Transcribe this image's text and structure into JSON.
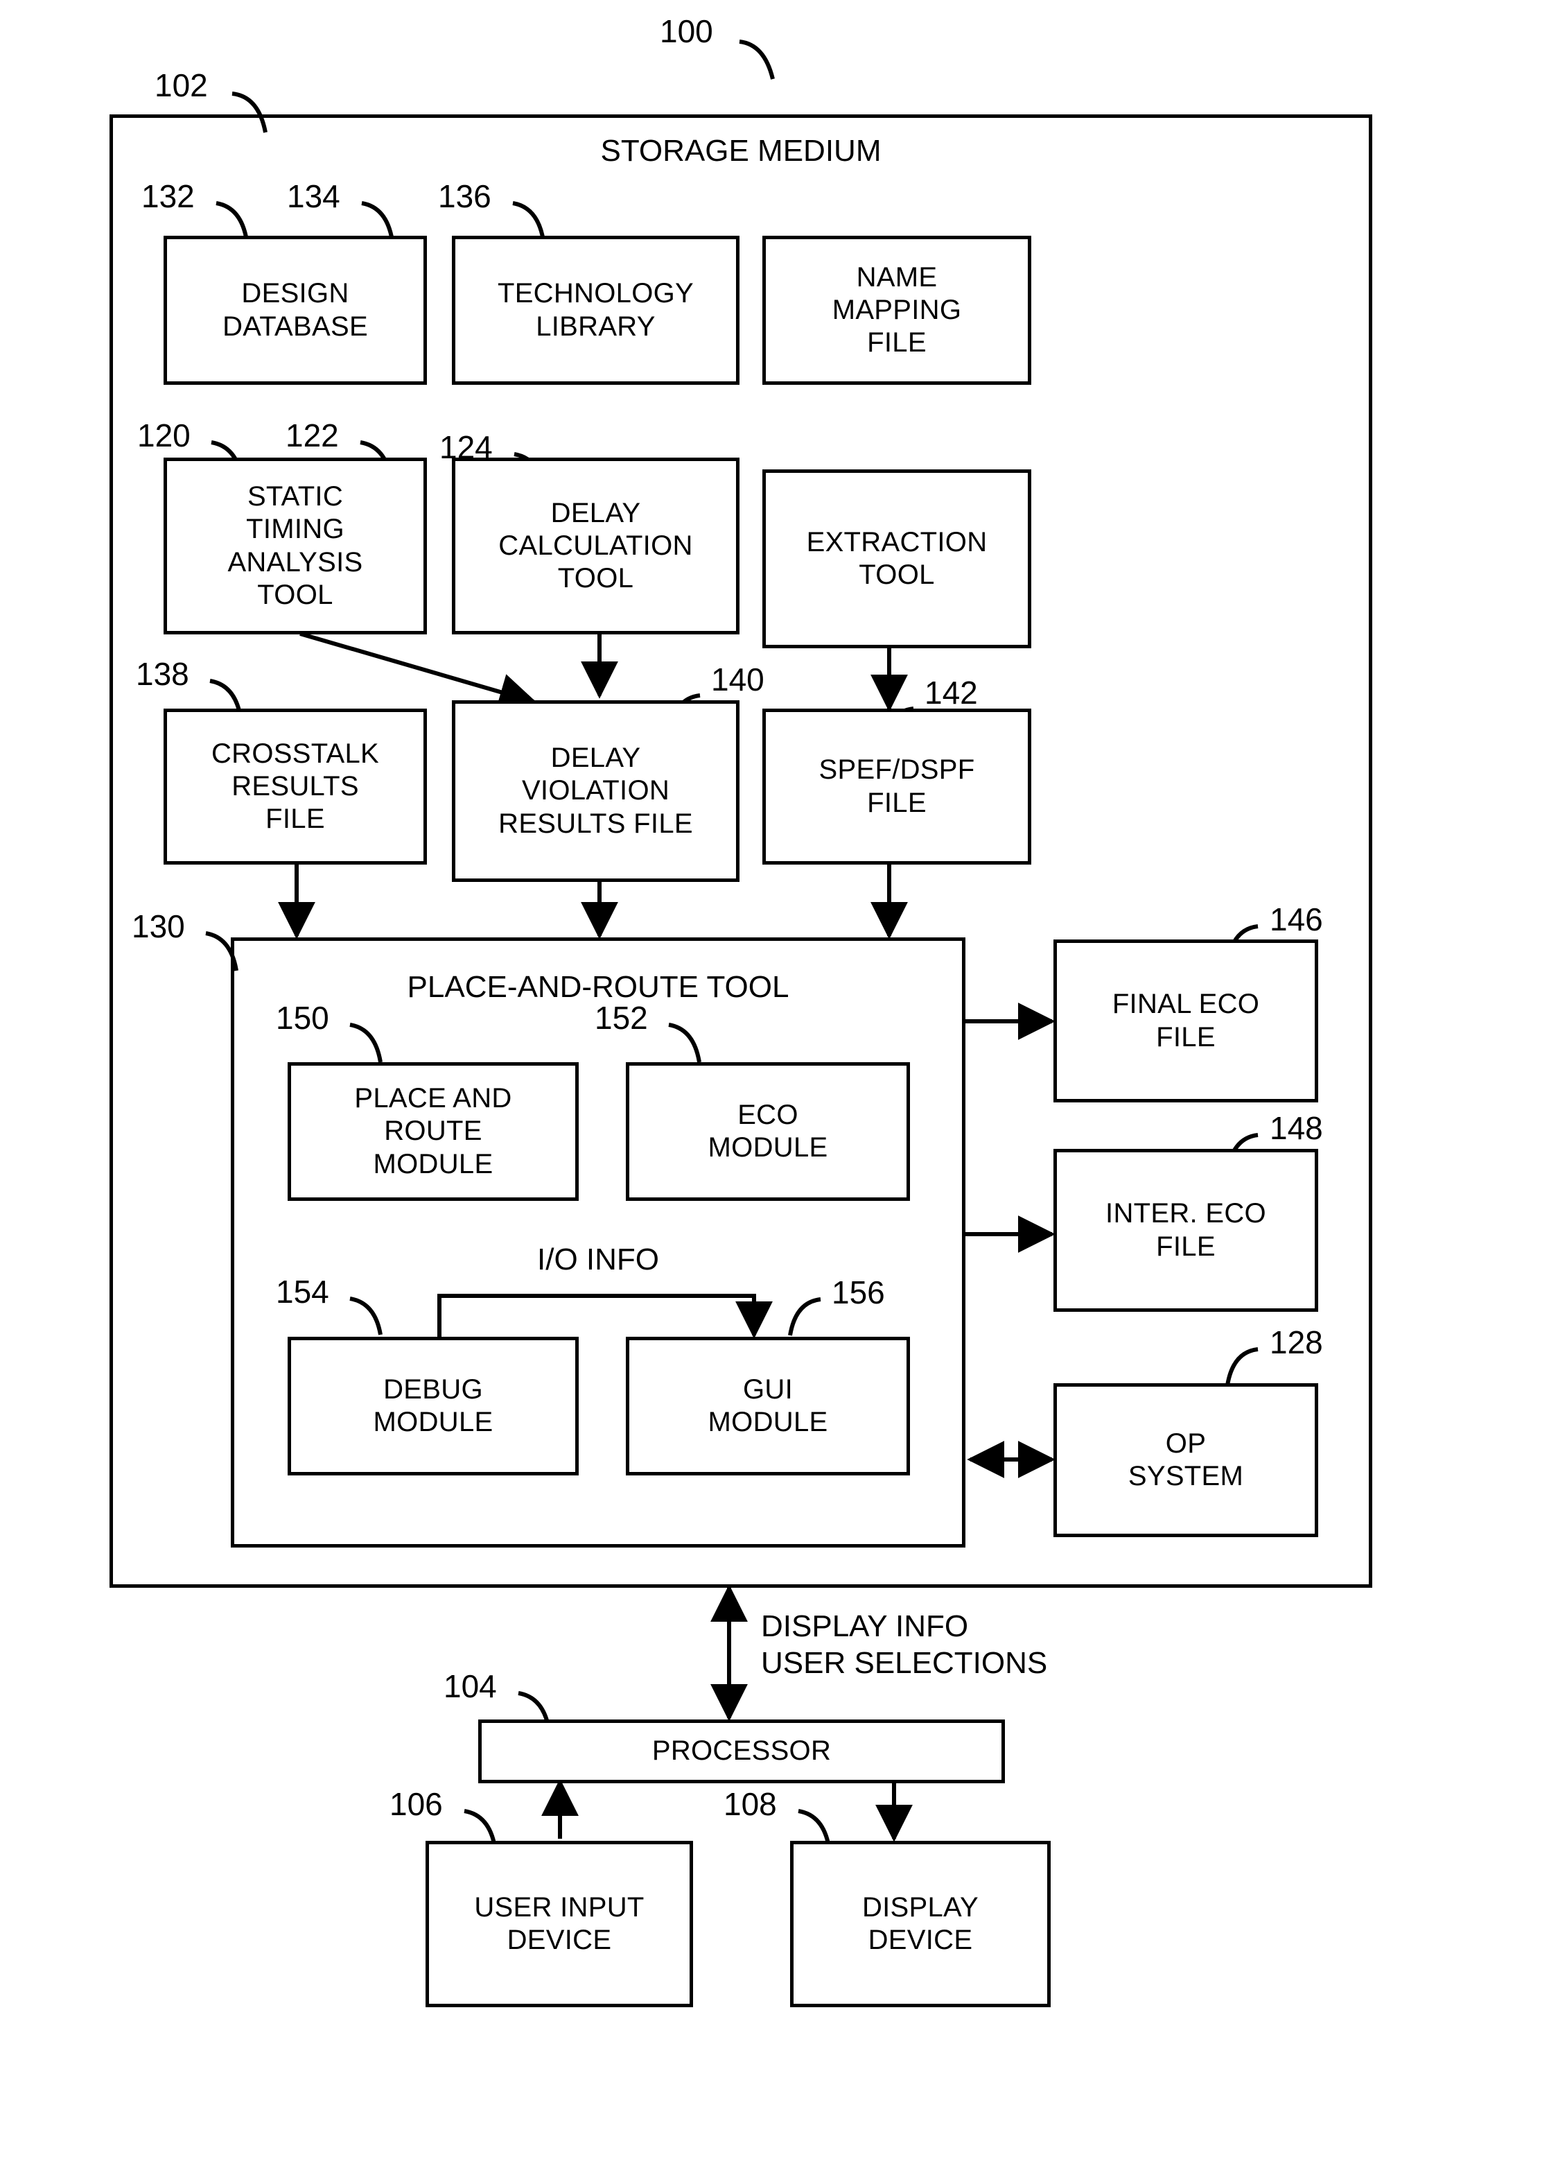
{
  "figure": {
    "top_ref": "100",
    "storage_medium": {
      "ref": "102",
      "title": "STORAGE MEDIUM"
    }
  },
  "blocks": {
    "design_database": {
      "ref": "132",
      "label": "DESIGN\nDATABASE"
    },
    "technology_library": {
      "ref": "134",
      "label": "TECHNOLOGY\nLIBRARY"
    },
    "name_mapping_file": {
      "ref": "136",
      "label": "NAME\nMAPPING\nFILE"
    },
    "static_timing": {
      "ref": "120",
      "label": "STATIC\nTIMING\nANALYSIS\nTOOL"
    },
    "delay_calculation": {
      "ref": "122",
      "label": "DELAY\nCALCULATION\nTOOL"
    },
    "extraction_tool": {
      "ref": "124",
      "label": "EXTRACTION\nTOOL"
    },
    "crosstalk_results": {
      "ref": "138",
      "label": "CROSSTALK\nRESULTS\nFILE"
    },
    "delay_violation": {
      "ref": "140",
      "label": "DELAY\nVIOLATION\nRESULTS FILE"
    },
    "spef_dspf_file": {
      "ref": "142",
      "label": "SPEF/DSPF\nFILE"
    },
    "place_and_route_tool": {
      "ref": "130",
      "label": "PLACE-AND-ROUTE TOOL"
    },
    "place_route_module": {
      "ref": "150",
      "label": "PLACE AND\nROUTE\nMODULE"
    },
    "eco_module": {
      "ref": "152",
      "label": "ECO\nMODULE"
    },
    "debug_module": {
      "ref": "154",
      "label": "DEBUG\nMODULE"
    },
    "gui_module": {
      "ref": "156",
      "label": "GUI\nMODULE"
    },
    "final_eco_file": {
      "ref": "146",
      "label": "FINAL ECO\nFILE"
    },
    "inter_eco_file": {
      "ref": "148",
      "label": "INTER. ECO\nFILE"
    },
    "op_system": {
      "ref": "128",
      "label": "OP\nSYSTEM"
    },
    "processor": {
      "ref": "104",
      "label": "PROCESSOR"
    },
    "user_input_device": {
      "ref": "106",
      "label": "USER INPUT\nDEVICE"
    },
    "display_device": {
      "ref": "108",
      "label": "DISPLAY\nDEVICE"
    }
  },
  "edge_labels": {
    "io_info": "I/O INFO",
    "display_info_user_selections": "DISPLAY INFO\nUSER SELECTIONS"
  },
  "colors": {
    "stroke": "#000000",
    "background": "#ffffff"
  }
}
